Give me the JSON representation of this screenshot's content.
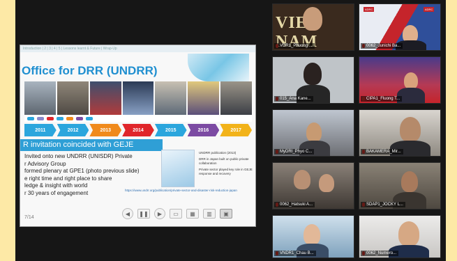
{
  "slide": {
    "header": "Introduction | 2 | 3 | 4 | 5 | Lessons learnt & Future | Wrap-Up",
    "title": "Office for DRR (UNDRR)",
    "timeline_years": [
      "2011",
      "2012",
      "2013",
      "2014",
      "2015",
      "2016",
      "2017"
    ],
    "timeline_colors": [
      "#2ba6dd",
      "#2ba6dd",
      "#f08a1c",
      "#e0262b",
      "#2ba6dd",
      "#7c4ba3",
      "#f2b31a"
    ],
    "banner": "R invitation coincided with GEJE",
    "bullets": [
      "Invited onto new UNDRR (UNISDR) Private",
      "r Advisory Group",
      "formed plenary at GPE1 (photo previous slide)",
      "e right time and right place to share",
      "ledge & insight with world",
      "r 30 years of engagement"
    ],
    "side_notes": [
      "UNDRR publication (2013)",
      "DRR in Japan built on public private collaboration",
      "Private sector played key role in GEJE response and recovery"
    ],
    "link_note": "https://www.undrr.org/publication/private-sector-and-disaster-risk-reduction-japan",
    "page_number": "7/14"
  },
  "participants": [
    {
      "name": "VDR1_Phuong ...",
      "bg": "#3a2a1e"
    },
    {
      "name": "0062_Junichi Ba...",
      "bg": "#c9cfe0"
    },
    {
      "name": "015_Ana Kane...",
      "bg": "#bfc4c8"
    },
    {
      "name": "CIPA1_Fluong T...",
      "bg": "#b43a55"
    },
    {
      "name": "MyDRI_Phyo C...",
      "bg": "#6d6f74"
    },
    {
      "name": "BAKAMERA_Mir...",
      "bg": "#8f8a82"
    },
    {
      "name": "0062_Hatsuki A...",
      "bg": "#5b534c"
    },
    {
      "name": "SDAP1_JOCKY L...",
      "bg": "#6a6258"
    },
    {
      "name": "VNDR1_Chau B...",
      "bg": "#9fb6c7"
    },
    {
      "name": "0062_Numero...",
      "bg": "#d8d6d4"
    }
  ],
  "overlay_text": {
    "vn": "VIET NAM"
  },
  "colors": {
    "background": "#fde9a6",
    "frame": "#161616",
    "accent": "#1f8fd0"
  }
}
